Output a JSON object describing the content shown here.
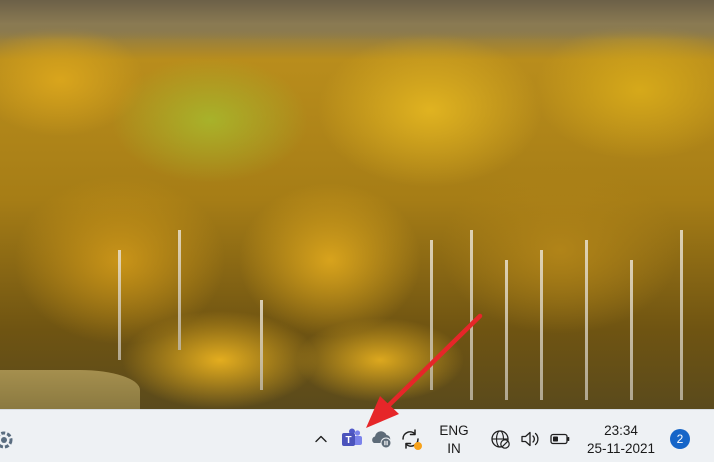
{
  "wallpaper": {
    "description_colors": {
      "accent_gold": "#d9a51c",
      "accent_green": "#a8b22a"
    }
  },
  "annotation": {
    "arrow_color": "#e62629"
  },
  "taskbar": {
    "tray": {
      "overflow_icon": "chevron-up-icon",
      "teams_icon": "teams-icon",
      "teams_letter": "T",
      "onedrive_icon": "onedrive-paused-icon",
      "sync_icon": "sync-icon",
      "language": {
        "line1": "ENG",
        "line2": "IN"
      },
      "network_icon": "globe-network-icon",
      "volume_icon": "speaker-icon",
      "battery_icon": "battery-icon"
    },
    "clock": {
      "time": "23:34",
      "date": "25-11-2021"
    },
    "notifications": {
      "count": "2",
      "badge_color": "#1665c8"
    }
  }
}
